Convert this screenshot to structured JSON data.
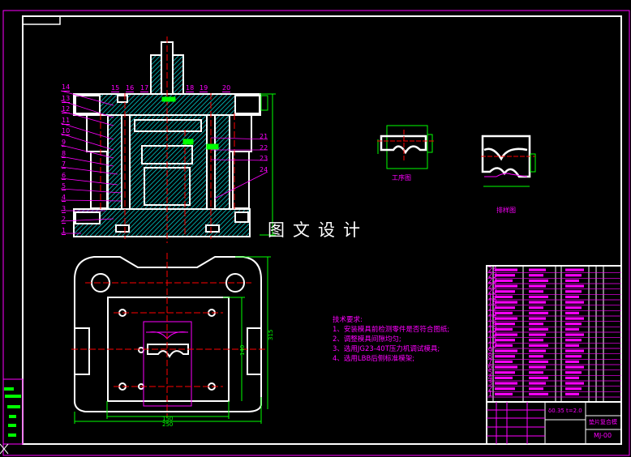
{
  "watermark": "图文设计",
  "assembly": {
    "part_callouts_left": [
      "14",
      "13",
      "12",
      "11",
      "10",
      "9",
      "8",
      "7",
      "6",
      "5",
      "4",
      "3",
      "2",
      "1"
    ],
    "part_callouts_top": [
      "15",
      "16",
      "17",
      "18",
      "19",
      "20"
    ],
    "part_callouts_right": [
      "21",
      "22",
      "23",
      "24"
    ]
  },
  "plan_view": {
    "dimensions": {
      "overall_width": "250",
      "inner_width": "150",
      "overall_height": "315",
      "inner_height": "140"
    }
  },
  "process_drawing": {
    "caption": "工序图"
  },
  "layout_drawing": {
    "caption": "排样图"
  },
  "technical_requirements": {
    "title": "技术要求:",
    "items": [
      "1、安装模具前检测零件是否符合图纸;",
      "2、调整模具间隙均匀;",
      "3、选用JG23-40T压力机调试模具;",
      "4、选用LBB后侧标准模架;"
    ]
  },
  "parts_list": {
    "row_numbers": [
      "24",
      "23",
      "22",
      "21",
      "20",
      "19",
      "18",
      "17",
      "16",
      "15",
      "14",
      "13",
      "12",
      "11",
      "10",
      "9",
      "8",
      "7",
      "6",
      "5",
      "4",
      "3",
      "2",
      "1"
    ]
  },
  "title_block": {
    "material_thickness": "δ0.35",
    "thickness": "t=2.0",
    "drawing_title": "垫片复合模",
    "drawing_number": "MJ-00"
  },
  "colors": {
    "outline": "#ffffff",
    "callout": "#ff00ff",
    "dimension": "#00ff00",
    "centerline": "#ff0000",
    "hatch": "#00ffff"
  }
}
